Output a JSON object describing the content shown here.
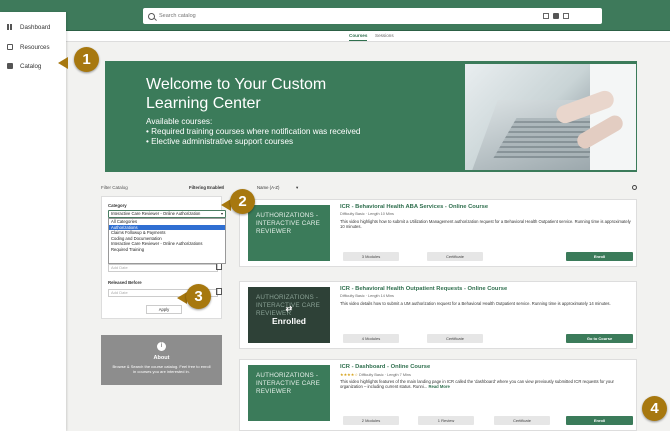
{
  "topbar": {
    "search_placeholder": "Search catalog"
  },
  "sidebar": {
    "items": [
      {
        "label": "Dashboard",
        "icon": "dashboard-icon"
      },
      {
        "label": "Resources",
        "icon": "document-icon"
      },
      {
        "label": "Catalog",
        "icon": "folder-icon"
      }
    ]
  },
  "tabs": [
    {
      "label": "Courses",
      "active": true
    },
    {
      "label": "Sessions",
      "active": false
    }
  ],
  "hero": {
    "title": "Welcome to Your Custom Learning Center",
    "subtitle_line1": "Available courses:",
    "subtitle_line2": "• Required training courses where notification was received",
    "subtitle_line3": "• Elective administrative support courses"
  },
  "filter": {
    "heading": "Filter Catalog",
    "enabled_label": "Filtering Enabled",
    "close_glyph": "×",
    "sort_label": "Name (A-Z)",
    "category_label": "Category",
    "category_value": "Interactive Care Reviewer - Online Authorization",
    "category_options": [
      "All Categories",
      "Authorizations",
      "Claims Followup & Payments",
      "Coding and Documentation",
      "Interactive Care Reviewer - Online Authorizations",
      "Required Training"
    ],
    "selected_option_index": 1,
    "date_placeholder": "Add Date",
    "released_before_label": "Released Before",
    "apply_label": "Apply"
  },
  "about": {
    "title": "About",
    "text": "Browse & Search the course catalog. Feel free to enroll in courses you are interested in.",
    "icon": "info-icon"
  },
  "courses": [
    {
      "thumb_text": "AUTHORIZATIONS - INTERACTIVE CARE REVIEWER",
      "title": "ICR - Behavioral Health ABA Services - Online Course",
      "meta": "Difficulty Basic   ·   Length 10 Mins",
      "desc": "This video highlights how to submit a Utilization Management authorization request for a Behavioral Health Outpatient service. Running time is approximately 10 minutes.",
      "modules": "3 Modules",
      "certificate": "Certificate",
      "action": "Enroll",
      "enrolled": false
    },
    {
      "thumb_text": "AUTHORIZATIONS - INTERACTIVE CARE REVIEWER",
      "title": "ICR - Behavioral Health Outpatient Requests - Online Course",
      "meta": "Difficulty Basic   ·   Length 14 Mins",
      "desc": "This video details how to submit a UM authorization request for a Behavioral Health Outpatient service. Running time is approximately 14 minutes.",
      "modules": "4 Modules",
      "certificate": "Certificate",
      "action": "Go to Course",
      "enrolled": true,
      "enrolled_label": "Enrolled",
      "enrolled_glyph": "⇄"
    },
    {
      "thumb_text": "AUTHORIZATIONS - INTERACTIVE CARE REVIEWER",
      "title": "ICR - Dashboard - Online Course",
      "stars": "★★★★☆",
      "meta": "Difficulty Basic   ·   Length 7 Mins",
      "desc": "This video highlights features of the main landing page in ICR called the 'dashboard' where you can view previously submitted ICR requests for your organization – including current status.  Runni...",
      "more": "Read More",
      "modules": "2 Modules",
      "reviews": "1 Review",
      "certificate": "Certificate",
      "action": "Enroll",
      "enrolled": false
    }
  ],
  "callouts": [
    "1",
    "2",
    "3",
    "4"
  ],
  "colors": {
    "brand_green": "#3b7b5a",
    "callout_gold": "#a7780f",
    "select_blue": "#2f6fd2"
  }
}
